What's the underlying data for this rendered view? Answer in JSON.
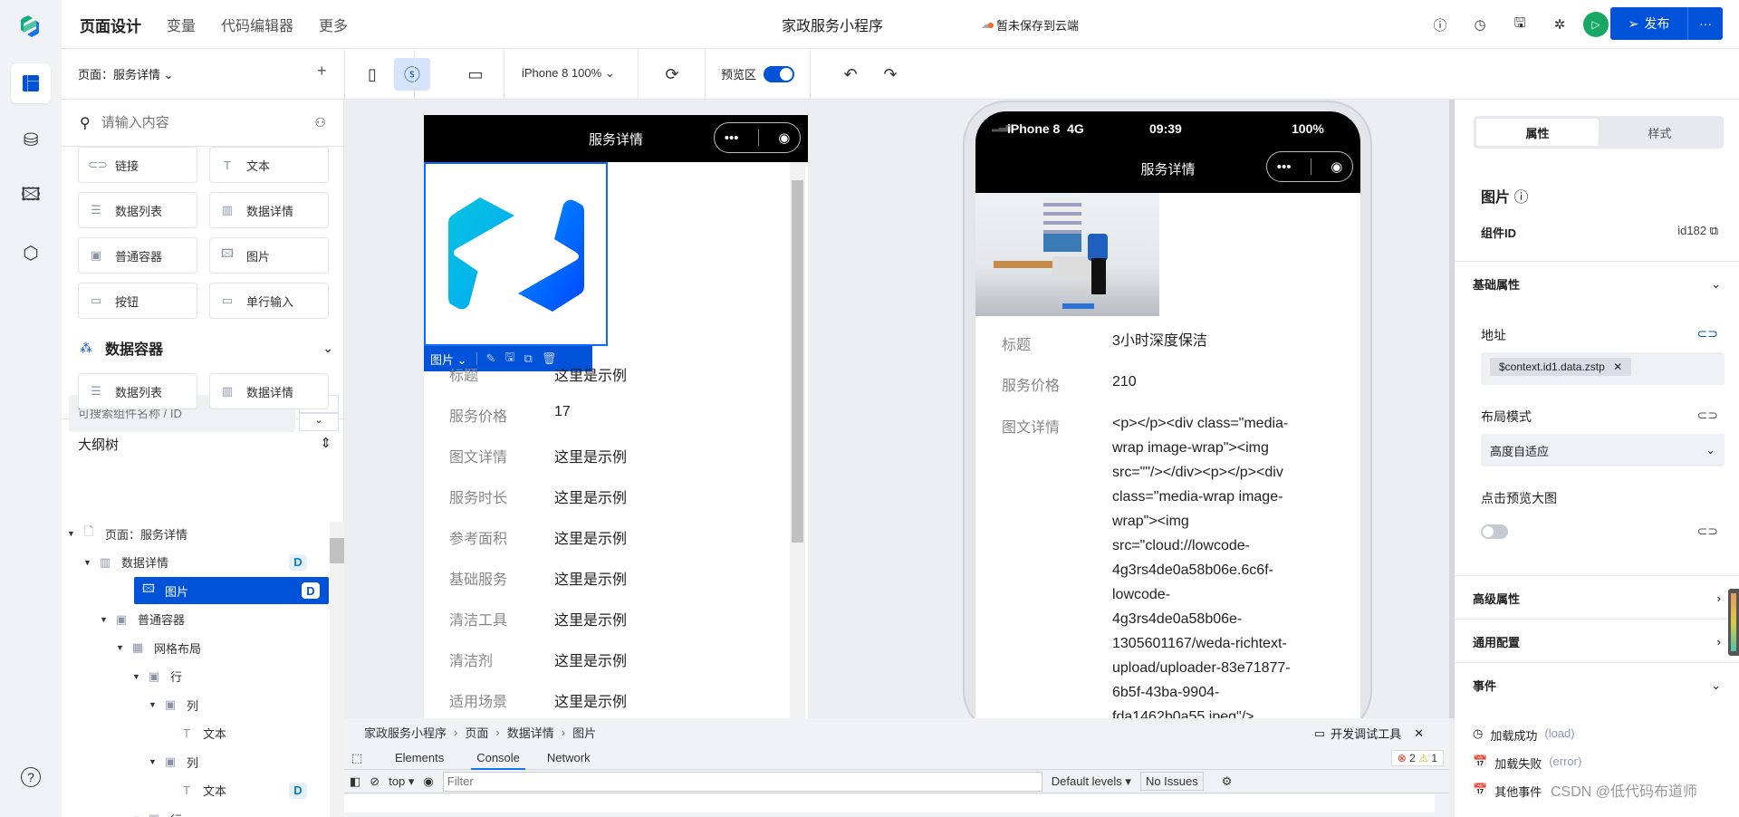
{
  "app": {
    "tabs": [
      "页面设计",
      "变量",
      "代码编辑器",
      "更多"
    ],
    "title": "家政服务小程序",
    "save_status": "暂未保存到云端",
    "publish": "发布",
    "more": "···"
  },
  "rail": {
    "icons": [
      "layout-icon",
      "database-icon",
      "image-icon",
      "component-icon",
      "help-icon"
    ]
  },
  "toolbar": {
    "device": "iPhone 8 100%",
    "preview_label": "预览区",
    "preview_on": true
  },
  "left": {
    "page_selector": "页面：服务详情",
    "add": "+",
    "search_placeholder": "请输入内容",
    "components": [
      {
        "label": "链接",
        "icon": "link-icon"
      },
      {
        "label": "文本",
        "icon": "text-icon"
      },
      {
        "label": "数据列表",
        "icon": "list-icon"
      },
      {
        "label": "数据详情",
        "icon": "chart-icon"
      },
      {
        "label": "普通容器",
        "icon": "container-icon"
      },
      {
        "label": "图片",
        "icon": "image-icon"
      },
      {
        "label": "按钮",
        "icon": "button-icon"
      },
      {
        "label": "单行输入",
        "icon": "input-icon"
      }
    ],
    "data_container_title": "数据容器",
    "data_container_items": [
      {
        "label": "数据列表",
        "icon": "list-icon"
      },
      {
        "label": "数据详情",
        "icon": "chart-icon"
      }
    ],
    "outline_title": "大纲树",
    "outline_search_placeholder": "可搜索组件名称 / ID",
    "tree": [
      {
        "label": "页面：服务详情",
        "level": 0,
        "icon": "page-icon",
        "expanded": true
      },
      {
        "label": "数据详情",
        "level": 1,
        "icon": "chart-icon",
        "expanded": true,
        "badge": "D"
      },
      {
        "label": "图片",
        "level": 2,
        "icon": "image-icon",
        "badge": "D",
        "selected": true
      },
      {
        "label": "普通容器",
        "level": 2,
        "icon": "container-icon",
        "expanded": true
      },
      {
        "label": "网格布局",
        "level": 3,
        "icon": "grid-icon",
        "expanded": true
      },
      {
        "label": "行",
        "level": 4,
        "icon": "container-icon",
        "expanded": true
      },
      {
        "label": "列",
        "level": 5,
        "icon": "container-icon",
        "expanded": true
      },
      {
        "label": "文本",
        "level": 6,
        "icon": "text-icon"
      },
      {
        "label": "列",
        "level": 5,
        "icon": "container-icon",
        "expanded": true
      },
      {
        "label": "文本",
        "level": 6,
        "icon": "text-icon",
        "badge": "D"
      },
      {
        "label": "行",
        "level": 4,
        "icon": "container-icon",
        "expanded": true
      }
    ]
  },
  "editor": {
    "nav_title": "服务详情",
    "selection_label": "图片",
    "rows": [
      {
        "label": "标题",
        "value": "这里是示例"
      },
      {
        "label": "服务价格",
        "value": "17"
      },
      {
        "label": "图文详情",
        "value": "这里是示例"
      },
      {
        "label": "服务时长",
        "value": "这里是示例"
      },
      {
        "label": "参考面积",
        "value": "这里是示例"
      },
      {
        "label": "基础服务",
        "value": "这里是示例"
      },
      {
        "label": "清洁工具",
        "value": "这里是示例"
      },
      {
        "label": "清洁剂",
        "value": "这里是示例"
      },
      {
        "label": "适用场景",
        "value": "这里是示例"
      }
    ]
  },
  "preview": {
    "carrier": "iPhone 8  4G",
    "time": "09:39",
    "battery": "100%",
    "nav_title": "服务详情",
    "rows": [
      {
        "label": "标题",
        "value": "3小时深度保洁"
      },
      {
        "label": "服务价格",
        "value": "210"
      },
      {
        "label": "图文详情",
        "value": "<p></p><div class=\"media-wrap image-wrap\"><img src=\"\"/></div><p></p><div class=\"media-wrap image-wrap\"><img src=\"cloud://lowcode-4g3rs4de0a58b06e.6c6f-lowcode-4g3rs4de0a58b06e-1305601167/weda-richtext-upload/uploader-83e71877-6b5f-43ba-9904-fda1462b0a55.jpeg\"/></div><p></p>"
      }
    ]
  },
  "breadcrumb": [
    "家政服务小程序",
    "页面",
    "数据详情",
    "图片"
  ],
  "devtools": {
    "toggle_label": "开发调试工具",
    "tabs": [
      "Elements",
      "Console",
      "Network"
    ],
    "active_tab": "Console",
    "errors": "2",
    "warnings": "1",
    "context": "top",
    "filter_placeholder": "Filter",
    "levels": "Default levels",
    "issues": "No Issues"
  },
  "right": {
    "tabs": [
      "属性",
      "样式"
    ],
    "active_tab": "属性",
    "component_title": "图片",
    "id_label": "组件ID",
    "id_value": "id182",
    "basic_title": "基础属性",
    "address_label": "地址",
    "address_value": "$context.id1.data.zstp",
    "layout_label": "布局模式",
    "layout_value": "高度自适应",
    "preview_label": "点击预览大图",
    "preview_enabled": false,
    "advanced_title": "高级属性",
    "common_title": "通用配置",
    "events_title": "事件",
    "events": [
      {
        "label": "加载成功",
        "code": "(load)",
        "icon": "clock-icon"
      },
      {
        "label": "加载失败",
        "code": "(error)",
        "icon": "calendar-icon"
      },
      {
        "label": "其他事件",
        "code": "",
        "icon": "calendar-icon"
      }
    ]
  },
  "watermark": "CSDN @低代码布道师",
  "colors": {
    "primary": "#0052d9",
    "run": "#16a864"
  }
}
